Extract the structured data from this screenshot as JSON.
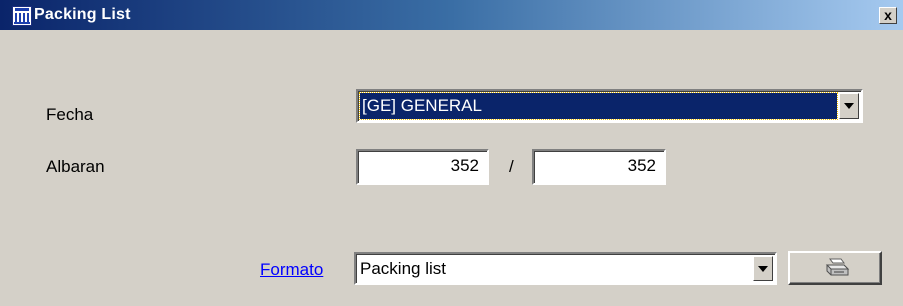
{
  "window": {
    "title": "Packing List",
    "close_symbol": "x",
    "icon": "app-logo-icon"
  },
  "form": {
    "fecha": {
      "label": "Fecha",
      "selected": "[GE] GENERAL"
    },
    "albaran": {
      "label": "Albaran",
      "from": "352",
      "separator": "/",
      "to": "352"
    },
    "formato": {
      "link_label": "Formato",
      "selected": "Packing list"
    },
    "print_button": {
      "icon": "printer-icon"
    }
  },
  "colors": {
    "titlebar_start": "#0a246a",
    "titlebar_end": "#a6caf0",
    "selection": "#0a246a",
    "link": "#0000ff",
    "face": "#d4d0c8"
  }
}
